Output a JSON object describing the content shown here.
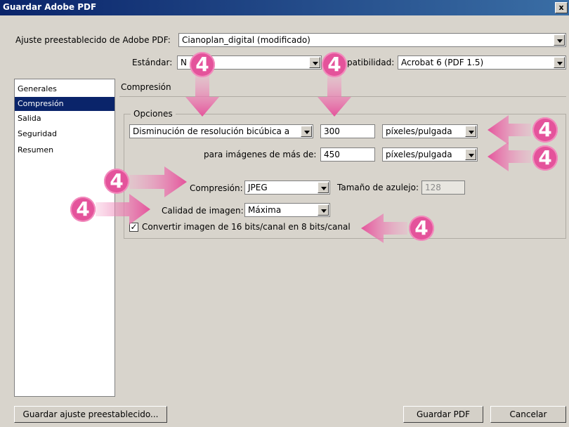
{
  "window": {
    "title": "Guardar Adobe PDF",
    "close_glyph": "x"
  },
  "preset": {
    "label": "Ajuste preestablecido de Adobe PDF:",
    "value": "Cianoplan_digital (modificado)"
  },
  "standard": {
    "label": "Estándar:",
    "value": "N"
  },
  "compat": {
    "label": "patibilidad:",
    "value": "Acrobat 6 (PDF 1.5)"
  },
  "sidebar": {
    "items": [
      {
        "label": "Generales",
        "selected": false
      },
      {
        "label": "Compresión",
        "selected": true
      },
      {
        "label": "Salida",
        "selected": false
      },
      {
        "label": "Seguridad",
        "selected": false
      },
      {
        "label": "Resumen",
        "selected": false
      }
    ]
  },
  "section_title": "Compresión",
  "options": {
    "legend": "Opciones",
    "resample_method": "Disminución de resolución bicúbica a",
    "resolution_value": "300",
    "resolution_unit": "píxeles/pulgada",
    "threshold_label": "para imágenes de más de:",
    "threshold_value": "450",
    "threshold_unit": "píxeles/pulgada",
    "compression_label": "Compresión:",
    "compression_value": "JPEG",
    "tile_label": "Tamaño de azulejo:",
    "tile_value": "128",
    "quality_label": "Calidad de imagen:",
    "quality_value": "Máxima",
    "convert_label": "Convertir imagen de 16 bits/canal en 8 bits/canal",
    "convert_checked": true
  },
  "buttons": {
    "save_preset": "Guardar ajuste preestablecido...",
    "save_pdf": "Guardar PDF",
    "cancel": "Cancelar"
  },
  "badges": {
    "label": "4",
    "color": "#e4539b"
  }
}
